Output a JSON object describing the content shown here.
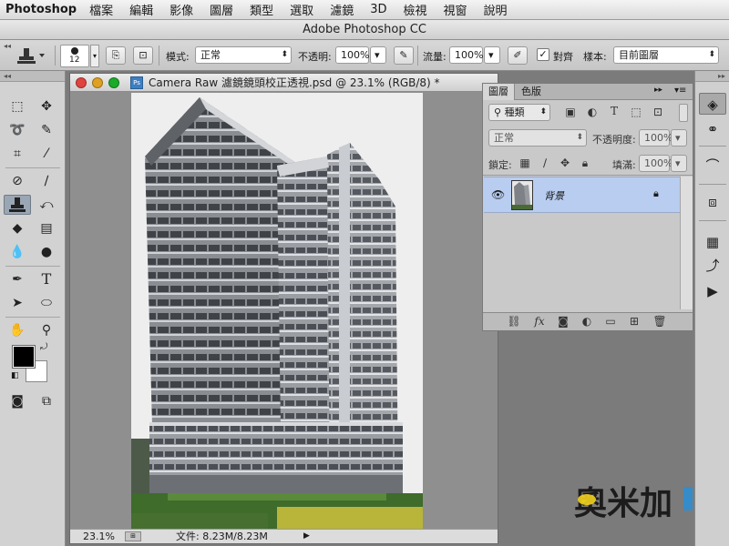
{
  "menubar": {
    "app": "Photoshop",
    "items": [
      "檔案",
      "編輯",
      "影像",
      "圖層",
      "類型",
      "選取",
      "濾鏡",
      "3D",
      "檢視",
      "視窗",
      "說明"
    ]
  },
  "window_title": "Adobe Photoshop CC",
  "options": {
    "brush_size": "12",
    "mode_label": "模式:",
    "mode_value": "正常",
    "opacity_label": "不透明:",
    "opacity_value": "100%",
    "flow_label": "流量:",
    "flow_value": "100%",
    "aligned_label": "對齊",
    "aligned_checked": true,
    "sample_label": "樣本:",
    "sample_value": "目前圖層"
  },
  "document": {
    "title": "Camera Raw 濾鏡鏡頭校正透視.psd @ 23.1% (RGB/8) *",
    "zoom": "23.1%",
    "file_info": "文件: 8.23M/8.23M"
  },
  "layers_panel": {
    "tabs": [
      "圖層",
      "色版"
    ],
    "filter_kind": "種類",
    "blend_mode": "正常",
    "opacity_label": "不透明度:",
    "opacity_value": "100%",
    "lock_label": "鎖定:",
    "fill_label": "填滿:",
    "fill_value": "100%",
    "layers": [
      {
        "name": "背景",
        "visible": true,
        "locked": true,
        "selected": true
      }
    ]
  },
  "watermark": {
    "text": "奧米加"
  },
  "colors": {
    "foreground": "#000000",
    "background": "#ffffff",
    "selected_layer": "#b8cdf0"
  }
}
